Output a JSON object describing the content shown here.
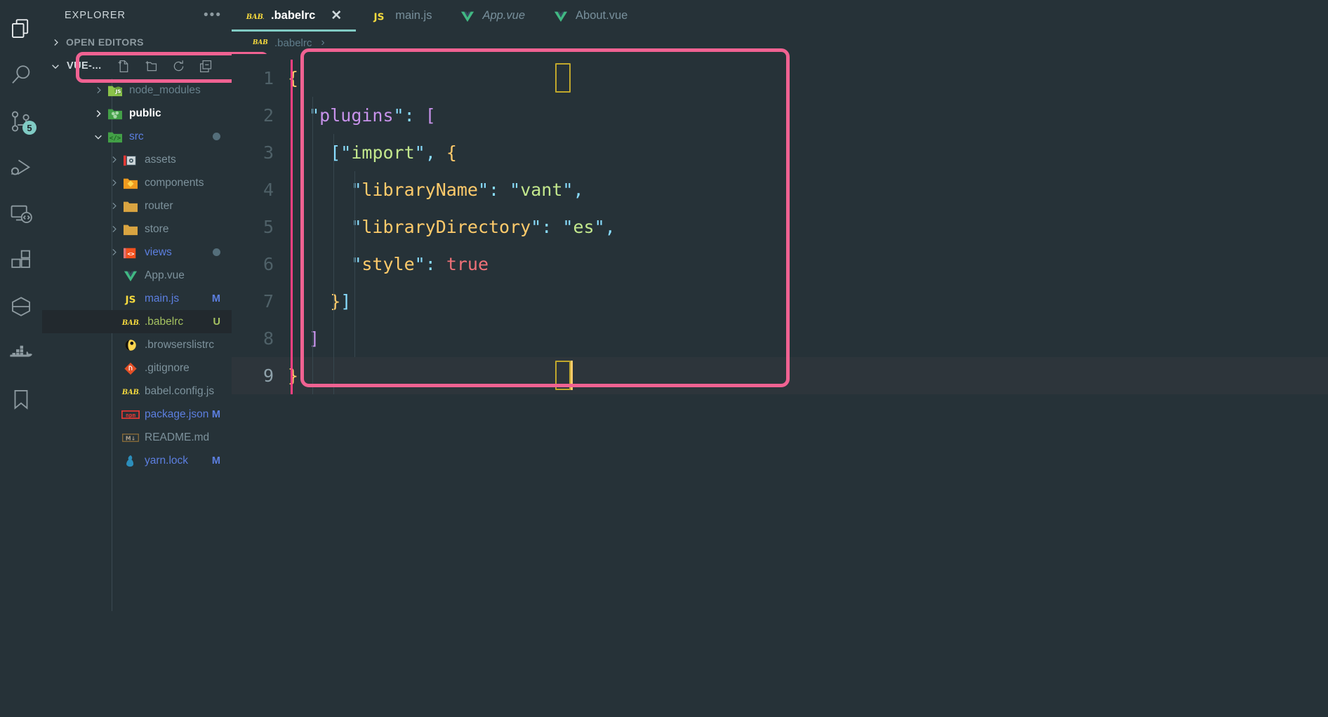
{
  "activity_bar": {
    "items": [
      {
        "name": "explorer",
        "icon": "files-icon",
        "active": true
      },
      {
        "name": "search",
        "icon": "search-icon",
        "active": false
      },
      {
        "name": "source-control",
        "icon": "source-control-icon",
        "badge": "5",
        "active": false
      },
      {
        "name": "run-and-debug",
        "icon": "run-debug-icon",
        "active": false
      },
      {
        "name": "remote-explorer",
        "icon": "remote-explorer-icon",
        "active": false
      },
      {
        "name": "extensions",
        "icon": "extensions-icon",
        "active": false
      },
      {
        "name": "vetur",
        "icon": "hexagon-icon",
        "active": false
      },
      {
        "name": "docker",
        "icon": "docker-icon",
        "active": false
      },
      {
        "name": "bookmarks",
        "icon": "bookmark-icon",
        "active": false
      }
    ]
  },
  "sidebar": {
    "title": "EXPLORER",
    "more_actions": "•••",
    "open_editors_label": "OPEN EDITORS",
    "project_name": "VUE-...",
    "project_actions": [
      "new-file",
      "new-folder",
      "refresh",
      "collapse-all"
    ],
    "tree": [
      {
        "label": "node_modules",
        "icon": "folder-node",
        "indent": 1,
        "twisty": "collapsed",
        "color": "dim"
      },
      {
        "label": "public",
        "icon": "folder-public",
        "indent": 1,
        "twisty": "collapsed",
        "color": "white"
      },
      {
        "label": "src",
        "icon": "folder-src",
        "indent": 1,
        "twisty": "expanded",
        "color": "blue",
        "dot": true
      },
      {
        "label": "assets",
        "icon": "folder-assets",
        "indent": 2,
        "twisty": "collapsed",
        "color": "grey"
      },
      {
        "label": "components",
        "icon": "folder-components",
        "indent": 2,
        "twisty": "collapsed",
        "color": "grey"
      },
      {
        "label": "router",
        "icon": "folder-plain",
        "indent": 2,
        "twisty": "collapsed",
        "color": "grey"
      },
      {
        "label": "store",
        "icon": "folder-plain",
        "indent": 2,
        "twisty": "collapsed",
        "color": "grey"
      },
      {
        "label": "views",
        "icon": "folder-views",
        "indent": 2,
        "twisty": "collapsed",
        "color": "blue",
        "dot": true
      },
      {
        "label": "App.vue",
        "icon": "vue-icon",
        "indent": 2,
        "twisty": "none",
        "color": "grey"
      },
      {
        "label": "main.js",
        "icon": "js-icon",
        "indent": 2,
        "twisty": "none",
        "color": "blue",
        "mark": "M",
        "mark_color": "blue"
      },
      {
        "label": ".babelrc",
        "icon": "babel-icon",
        "indent": 2,
        "twisty": "none",
        "color": "green",
        "mark": "U",
        "mark_color": "green",
        "selected": true
      },
      {
        "label": ".browserslistrc",
        "icon": "browserslist-icon",
        "indent": 2,
        "twisty": "none",
        "color": "grey"
      },
      {
        "label": ".gitignore",
        "icon": "git-icon",
        "indent": 2,
        "twisty": "none",
        "color": "grey"
      },
      {
        "label": "babel.config.js",
        "icon": "babel-icon",
        "indent": 2,
        "twisty": "none",
        "color": "grey"
      },
      {
        "label": "package.json",
        "icon": "npm-icon",
        "indent": 2,
        "twisty": "none",
        "color": "blue",
        "mark": "M",
        "mark_color": "blue"
      },
      {
        "label": "README.md",
        "icon": "markdown-icon",
        "indent": 2,
        "twisty": "none",
        "color": "grey"
      },
      {
        "label": "yarn.lock",
        "icon": "yarn-icon",
        "indent": 2,
        "twisty": "none",
        "color": "blue",
        "mark": "M",
        "mark_color": "blue"
      }
    ]
  },
  "tabs": [
    {
      "label": ".babelrc",
      "icon": "babel-icon",
      "active": true,
      "italic": false,
      "close": "✕"
    },
    {
      "label": "main.js",
      "icon": "js-icon",
      "active": false,
      "italic": false
    },
    {
      "label": "App.vue",
      "icon": "vue-icon",
      "active": false,
      "italic": true
    },
    {
      "label": "About.vue",
      "icon": "vue-icon",
      "active": false,
      "italic": false
    }
  ],
  "breadcrumb": {
    "file": ".babelrc",
    "icon": "babel-icon",
    "separator": "›"
  },
  "editor": {
    "file": ".babelrc",
    "language": "json",
    "cursor_line": 9,
    "lines": [
      {
        "n": "1",
        "tokens": [
          {
            "t": "{",
            "c": "brace-y"
          }
        ]
      },
      {
        "n": "2",
        "tokens": [
          {
            "t": "  ",
            "c": "plain"
          },
          {
            "t": "\"",
            "c": "quote"
          },
          {
            "t": "plugins",
            "c": "pink"
          },
          {
            "t": "\"",
            "c": "quote"
          },
          {
            "t": ":",
            "c": "quote"
          },
          {
            "t": " ",
            "c": "plain"
          },
          {
            "t": "[",
            "c": "pink"
          }
        ]
      },
      {
        "n": "3",
        "tokens": [
          {
            "t": "    ",
            "c": "plain"
          },
          {
            "t": "[",
            "c": "brack-b"
          },
          {
            "t": "\"",
            "c": "quote"
          },
          {
            "t": "import",
            "c": "str"
          },
          {
            "t": "\"",
            "c": "quote"
          },
          {
            "t": ",",
            "c": "quote"
          },
          {
            "t": " ",
            "c": "plain"
          },
          {
            "t": "{",
            "c": "brace-y"
          }
        ]
      },
      {
        "n": "4",
        "tokens": [
          {
            "t": "      ",
            "c": "plain"
          },
          {
            "t": "\"",
            "c": "quote"
          },
          {
            "t": "libraryName",
            "c": "key"
          },
          {
            "t": "\"",
            "c": "quote"
          },
          {
            "t": ":",
            "c": "quote"
          },
          {
            "t": " ",
            "c": "plain"
          },
          {
            "t": "\"",
            "c": "quote"
          },
          {
            "t": "vant",
            "c": "str"
          },
          {
            "t": "\"",
            "c": "quote"
          },
          {
            "t": ",",
            "c": "quote"
          }
        ]
      },
      {
        "n": "5",
        "tokens": [
          {
            "t": "      ",
            "c": "plain"
          },
          {
            "t": "\"",
            "c": "quote"
          },
          {
            "t": "libraryDirectory",
            "c": "key"
          },
          {
            "t": "\"",
            "c": "quote"
          },
          {
            "t": ":",
            "c": "quote"
          },
          {
            "t": " ",
            "c": "plain"
          },
          {
            "t": "\"",
            "c": "quote"
          },
          {
            "t": "es",
            "c": "str"
          },
          {
            "t": "\"",
            "c": "quote"
          },
          {
            "t": ",",
            "c": "quote"
          }
        ]
      },
      {
        "n": "6",
        "tokens": [
          {
            "t": "      ",
            "c": "plain"
          },
          {
            "t": "\"",
            "c": "quote"
          },
          {
            "t": "style",
            "c": "key"
          },
          {
            "t": "\"",
            "c": "quote"
          },
          {
            "t": ":",
            "c": "quote"
          },
          {
            "t": " ",
            "c": "plain"
          },
          {
            "t": "true",
            "c": "bool"
          }
        ]
      },
      {
        "n": "7",
        "tokens": [
          {
            "t": "    ",
            "c": "plain"
          },
          {
            "t": "}",
            "c": "brace-y"
          },
          {
            "t": "]",
            "c": "brack-b"
          }
        ]
      },
      {
        "n": "8",
        "tokens": [
          {
            "t": "  ",
            "c": "plain"
          },
          {
            "t": "]",
            "c": "pink"
          }
        ]
      },
      {
        "n": "9",
        "tokens": [
          {
            "t": "}",
            "c": "brace-y"
          }
        ]
      }
    ],
    "raw_text": "{\n  \"plugins\": [\n    [\"import\", {\n      \"libraryName\": \"vant\",\n      \"libraryDirectory\": \"es\",\n      \"style\": true\n    }]\n  ]\n}"
  },
  "annotations": {
    "highlight_color": "#F06292",
    "boxes": [
      {
        "name": "babelrc-file-highlight",
        "target": ".babelrc"
      },
      {
        "name": "code-content-highlight",
        "target": "editor-code"
      }
    ]
  },
  "colors": {
    "background": "#263238",
    "accent_teal": "#80CBC4",
    "accent_pink": "#F06292",
    "cursor_pink": "#FF4081",
    "string_green": "#C3E88D",
    "key_orange": "#FFCB6B",
    "punct_cyan": "#89DDFF",
    "bool_salmon": "#F07178",
    "pink_bracket": "#C792EA"
  }
}
